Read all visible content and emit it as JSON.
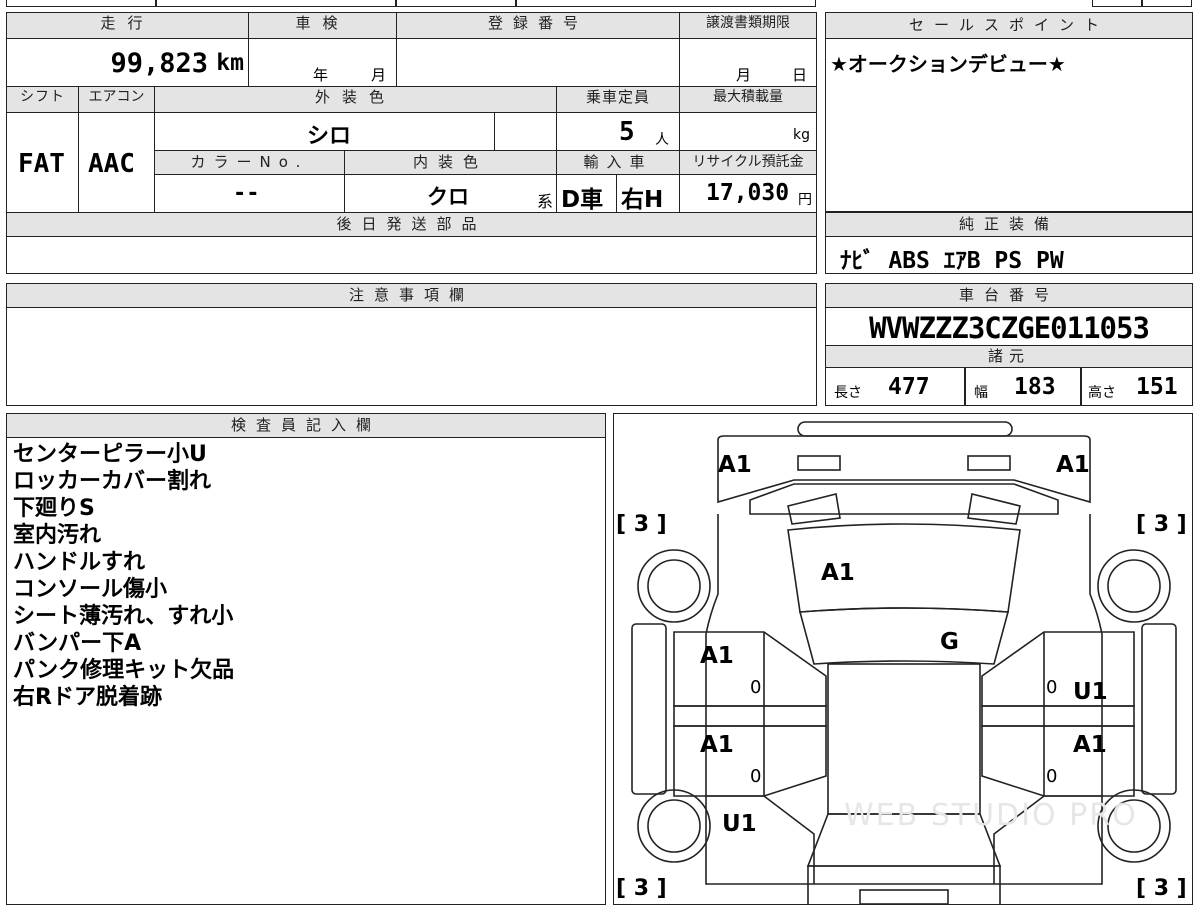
{
  "mileage": {
    "label": "走行",
    "value": "99,823",
    "unit": "km"
  },
  "shaken": {
    "label": "車検",
    "year_unit": "年",
    "month_unit": "月"
  },
  "registration": {
    "label": "登録番号"
  },
  "transfer_deadline": {
    "label": "譲渡書類期限",
    "month_unit": "月",
    "day_unit": "日"
  },
  "shift": {
    "label": "シフト",
    "value": "FAT"
  },
  "aircon": {
    "label": "エアコン",
    "value": "AAC"
  },
  "exterior_color": {
    "label": "外装色",
    "value": "シロ"
  },
  "capacity": {
    "label": "乗車定員",
    "value": "5",
    "unit": "人"
  },
  "max_load": {
    "label": "最大積載量",
    "unit": "kg"
  },
  "color_no": {
    "label": "カラーNo.",
    "value": "--"
  },
  "interior_color": {
    "label": "内装色",
    "value": "クロ",
    "suffix": "系"
  },
  "import": {
    "label": "輸入車",
    "dealer": "D車",
    "steering": "右H"
  },
  "recycle": {
    "label": "リサイクル預託金",
    "value": "17,030",
    "unit": "円"
  },
  "later_parts": {
    "label": "後日発送部品"
  },
  "notes": {
    "label": "注意事項欄"
  },
  "sales_point": {
    "label": "セールスポイント",
    "text": "★オークションデビュー★"
  },
  "equipment": {
    "label": "純正装備",
    "value": "ﾅﾋﾞ ABS ｴｱB PS PW"
  },
  "chassis": {
    "label": "車台番号",
    "value": "WVWZZZ3CZGE011053"
  },
  "specs": {
    "label": "諸元",
    "length_label": "長さ",
    "length": "477",
    "width_label": "幅",
    "width": "183",
    "height_label": "高さ",
    "height": "151"
  },
  "inspector": {
    "label": "検査員記入欄",
    "lines": [
      "センターピラー小U",
      "ロッカーカバー割れ",
      "下廻りS",
      "室内汚れ",
      "ハンドルすれ",
      "コンソール傷小",
      "シート薄汚れ、すれ小",
      "バンパー下A",
      "パンク修理キット欠品",
      "右Rドア脱着跡"
    ]
  },
  "diagram": {
    "marks": {
      "fl_bumper": "A1",
      "fr_bumper": "A1",
      "windshield": "A1",
      "roof": "G",
      "lf_door": "A1",
      "rf_door": "U1",
      "lr_door": "A1",
      "rr_door": "A1",
      "lr_wheel": "U1"
    },
    "tires": {
      "fl": "[ 3 ]",
      "fr": "[ 3 ]",
      "rl": "[ 3 ]",
      "rr": "[ 3 ]"
    },
    "zeros": {
      "lf": "0",
      "rf": "0",
      "lr": "0",
      "rr": "0"
    },
    "watermark": "WEB STUDIO PRO"
  }
}
